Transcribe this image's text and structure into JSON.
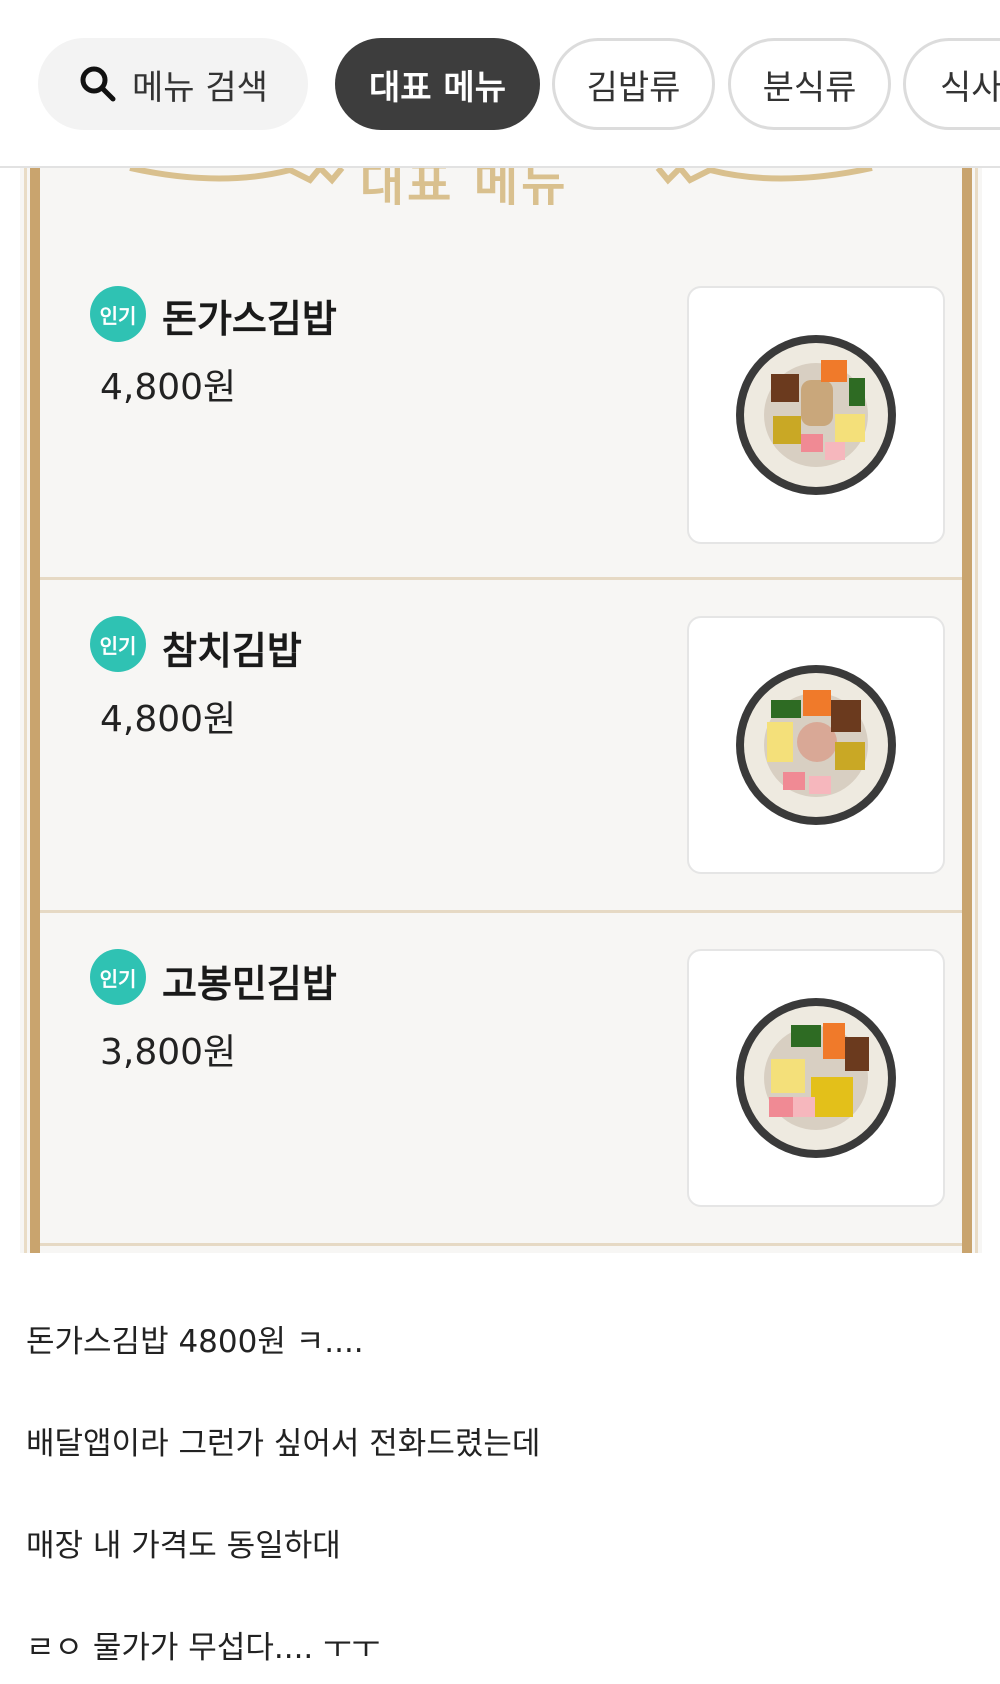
{
  "tabs": {
    "search_label": "메뉴 검색",
    "items": [
      "대표 메뉴",
      "김밥류",
      "분식류",
      "식사"
    ]
  },
  "section": {
    "title": "대표 메뉴"
  },
  "menu_items": [
    {
      "badge": "인기",
      "name": "돈가스김밥",
      "price": "4,800원"
    },
    {
      "badge": "인기",
      "name": "참치김밥",
      "price": "4,800원"
    },
    {
      "badge": "인기",
      "name": "고봉민김밥",
      "price": "3,800원"
    }
  ],
  "post_lines": [
    "돈가스김밥 4800원 ㅋ....",
    "배달앱이라 그런가 싶어서 전화드렸는데",
    "매장 내 가격도 동일하대",
    "ㄹㅇ 물가가 무섭다.... ㅜㅜ"
  ],
  "colors": {
    "badge": "#2fc2b3",
    "frame": "#c9a46e",
    "active_tab": "#3d3d3d"
  }
}
